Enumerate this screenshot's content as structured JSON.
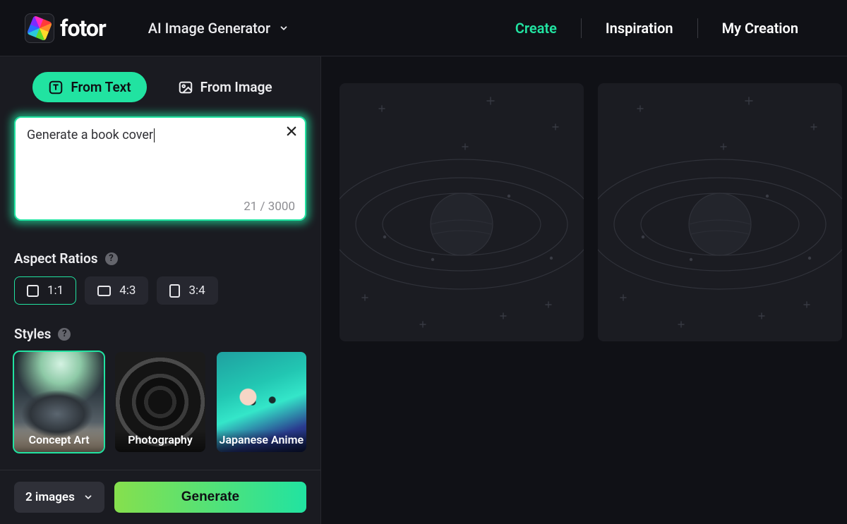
{
  "header": {
    "brand": "fotor",
    "title_dropdown": "AI Image Generator",
    "nav": {
      "create": "Create",
      "inspiration": "Inspiration",
      "my_creation": "My Creation"
    }
  },
  "sidebar": {
    "modes": {
      "from_text": "From Text",
      "from_image": "From Image"
    },
    "prompt": {
      "value": "Generate a book cover",
      "counter": "21 / 3000"
    },
    "aspect_ratio_title": "Aspect Ratios",
    "ratios": [
      {
        "label": "1:1",
        "active": true
      },
      {
        "label": "4:3",
        "active": false
      },
      {
        "label": "3:4",
        "active": false
      }
    ],
    "styles_title": "Styles",
    "styles": [
      {
        "label": "Concept Art",
        "active": true
      },
      {
        "label": "Photography",
        "active": false
      },
      {
        "label": "Japanese Anime",
        "active": false
      }
    ],
    "count_select": "2 images",
    "generate_label": "Generate"
  }
}
